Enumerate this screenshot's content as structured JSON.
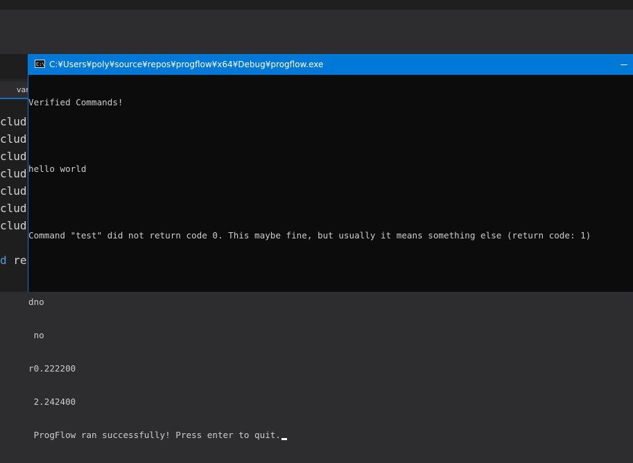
{
  "ide": {
    "tab_label": "var",
    "code_lines": [
      "clud",
      "clud",
      "clud",
      "clud",
      "clud",
      "clud",
      "clud"
    ],
    "code_keyword": "d",
    "code_rest": " re"
  },
  "console": {
    "title": "C:¥Users¥poly¥source¥repos¥progflow¥x64¥Debug¥progflow.exe",
    "icon_text": "C:\\",
    "lines": [
      "Verified Commands!",
      "",
      "hello world",
      "",
      "Command \"test\" did not return code 0. This maybe fine, but usually it means something else (return code: 1)",
      "",
      "dno",
      " no",
      "r0.222200",
      " 2.242400",
      " ProgFlow ran successfully! Press enter to quit."
    ]
  },
  "colors": {
    "titlebar": "#0078d7",
    "console_bg": "#0c0c0c",
    "console_text": "#cccccc",
    "keyword": "#569cd6"
  }
}
